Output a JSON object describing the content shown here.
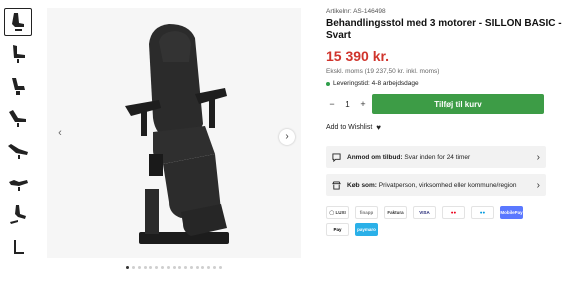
{
  "thumbnails": [
    {
      "name": "chair-front"
    },
    {
      "name": "chair-side"
    },
    {
      "name": "chair-semi"
    },
    {
      "name": "chair-recline"
    },
    {
      "name": "chair-flat"
    },
    {
      "name": "chair-angle"
    },
    {
      "name": "chair-sitting"
    },
    {
      "name": "chair-low"
    }
  ],
  "product": {
    "artno": "Artikelnr: AS-146498",
    "title": "Behandlingsstol med 3 motorer - SILLON BASIC - Svart",
    "price": "15 390 kr.",
    "price_ex": "Ekskl. moms (19 237,50 kr. inkl. moms)",
    "delivery": "Leveringstid: 4-8 arbejdsdage"
  },
  "buy": {
    "minus": "−",
    "qty": "1",
    "plus": "+",
    "cart_label": "Tilføj til kurv"
  },
  "wishlist": {
    "label": "Add to Wishlist"
  },
  "offer": {
    "strong": "Anmod om tilbud:",
    "text": " Svar inden for 24 timer"
  },
  "buy_as": {
    "strong": "Køb som:",
    "text": " Privatperson, virksomhed eller kommune/region"
  },
  "payments": [
    {
      "label": "◯ LUXI",
      "bg": "#ffffff",
      "fg": "#333"
    },
    {
      "label": "finapp",
      "bg": "#ffffff",
      "fg": "#777"
    },
    {
      "label": "Faktura",
      "bg": "#ffffff",
      "fg": "#333"
    },
    {
      "label": "VISA",
      "bg": "#ffffff",
      "fg": "#1a1f71"
    },
    {
      "label": "●●",
      "bg": "#ffffff",
      "fg": "#eb001b"
    },
    {
      "label": "●●",
      "bg": "#ffffff",
      "fg": "#0099df"
    },
    {
      "label": "MobilePay",
      "bg": "#5a78ff",
      "fg": "#ffffff"
    },
    {
      "label": " Pay",
      "bg": "#ffffff",
      "fg": "#000"
    },
    {
      "label": "paymaro",
      "bg": "#2ab0e8",
      "fg": "#ffffff"
    }
  ],
  "gallery": {
    "dots_total": 17,
    "dot_active": 0
  },
  "colors": {
    "price": "#d0342c",
    "cart": "#3d9c46",
    "delivery_dot": "#2e9e4a"
  }
}
